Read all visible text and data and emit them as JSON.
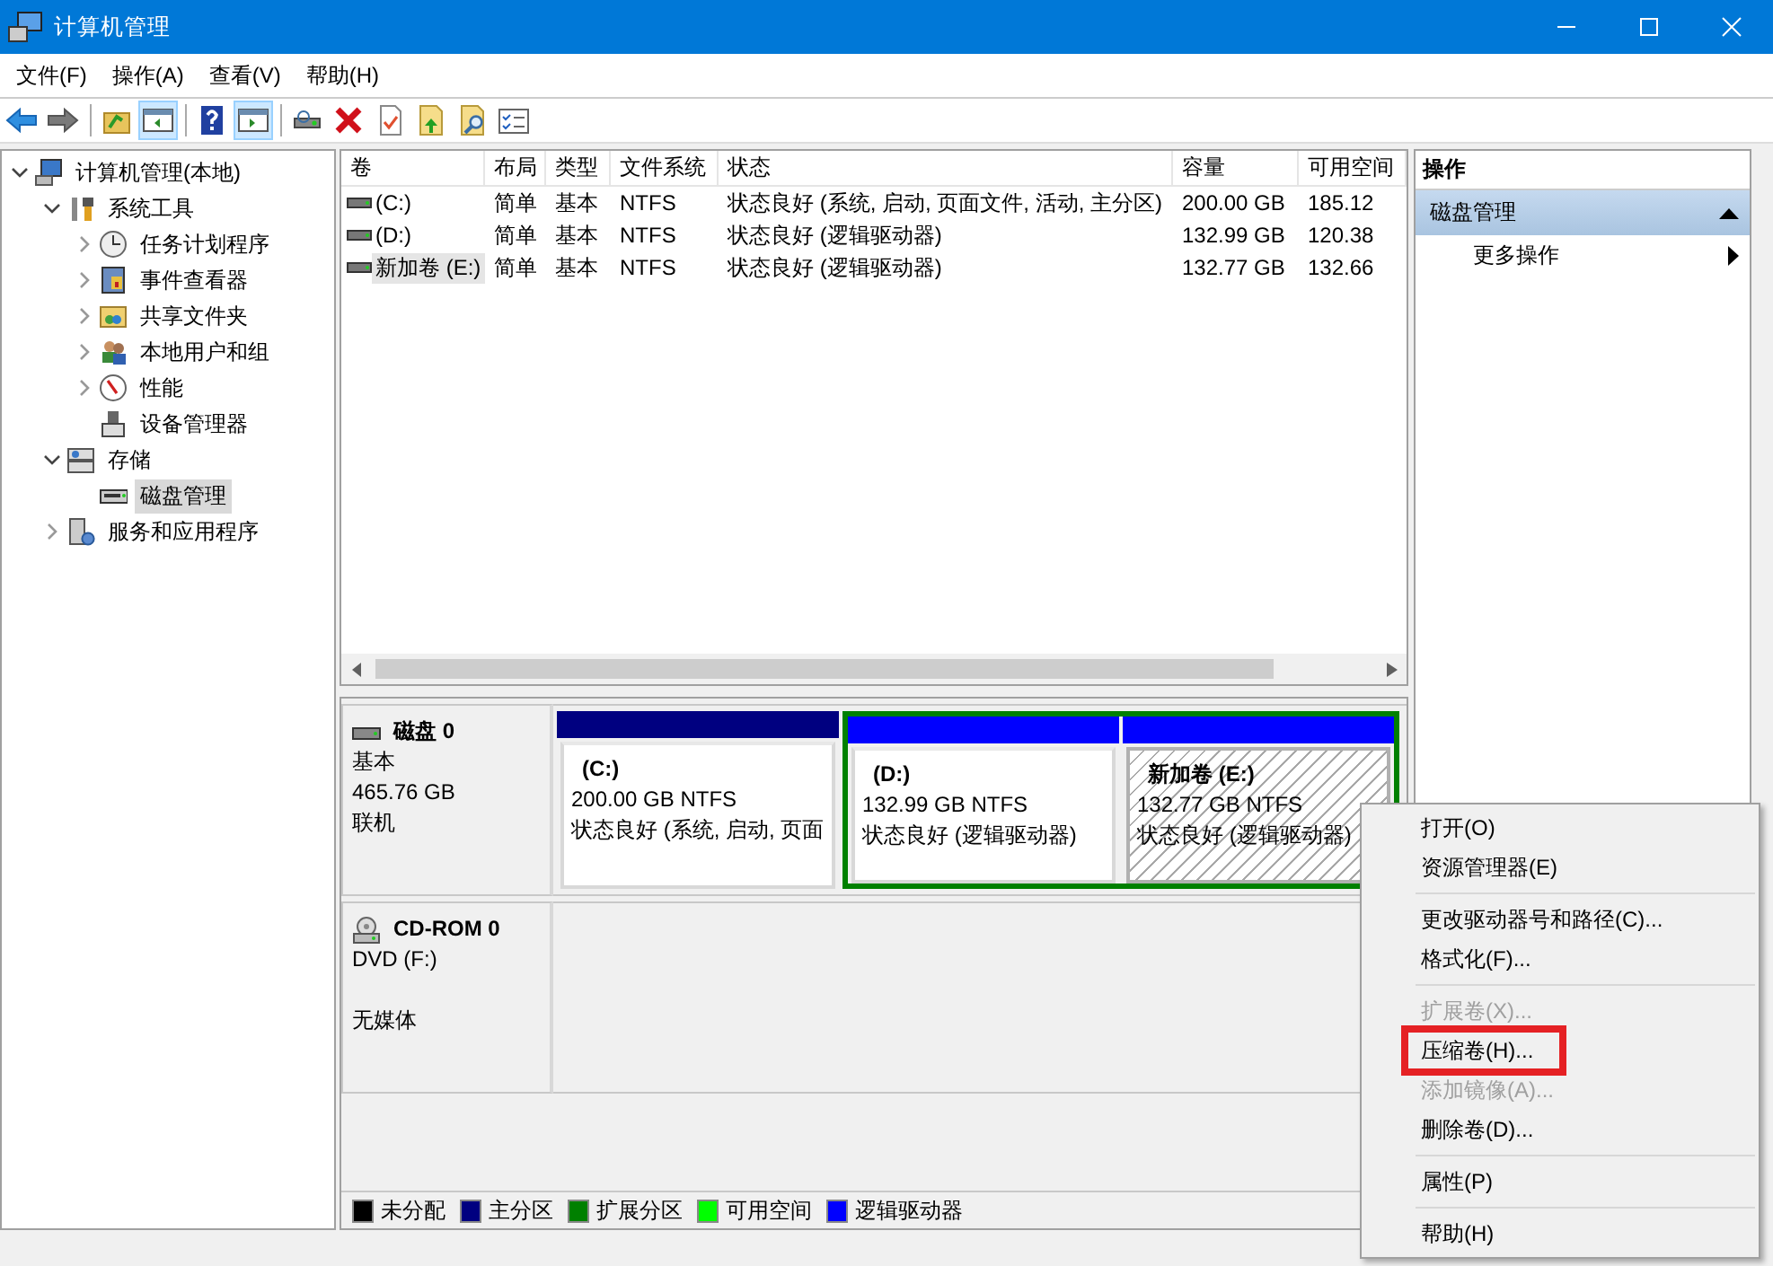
{
  "window": {
    "title": "计算机管理"
  },
  "menu_bar": [
    {
      "label": "文件(F)"
    },
    {
      "label": "操作(A)"
    },
    {
      "label": "查看(V)"
    },
    {
      "label": "帮助(H)"
    }
  ],
  "toolbar": [
    [
      {
        "kind": "back",
        "pressed": false
      },
      {
        "kind": "forward",
        "pressed": false
      }
    ],
    [
      {
        "kind": "up",
        "pressed": false
      },
      {
        "kind": "tree-pane",
        "pressed": true
      }
    ],
    [
      {
        "kind": "help",
        "pressed": false
      },
      {
        "kind": "action-pane",
        "pressed": true
      }
    ],
    [
      {
        "kind": "connect",
        "pressed": false
      },
      {
        "kind": "delete",
        "pressed": false
      },
      {
        "kind": "check",
        "pressed": false
      },
      {
        "kind": "folder-up",
        "pressed": false
      },
      {
        "kind": "folder-search",
        "pressed": false
      },
      {
        "kind": "checklist",
        "pressed": false
      }
    ]
  ],
  "tree": [
    {
      "label": "计算机管理(本地)",
      "kind": "computer",
      "selected": false,
      "expanded": true,
      "children": [
        {
          "label": "系统工具",
          "kind": "tools",
          "selected": false,
          "expanded": true,
          "children": [
            {
              "label": "任务计划程序",
              "kind": "clock",
              "selected": false,
              "expanded": false
            },
            {
              "label": "事件查看器",
              "kind": "event",
              "selected": false,
              "expanded": false
            },
            {
              "label": "共享文件夹",
              "kind": "share",
              "selected": false,
              "expanded": false
            },
            {
              "label": "本地用户和组",
              "kind": "users",
              "selected": false,
              "expanded": false
            },
            {
              "label": "性能",
              "kind": "perf",
              "selected": false,
              "expanded": false
            },
            {
              "label": "设备管理器",
              "kind": "device",
              "selected": false
            }
          ]
        },
        {
          "label": "存储",
          "kind": "storage",
          "selected": false,
          "expanded": true,
          "children": [
            {
              "label": "磁盘管理",
              "kind": "disk",
              "selected": true
            }
          ]
        },
        {
          "label": "服务和应用程序",
          "kind": "services",
          "selected": false,
          "expanded": false
        }
      ]
    }
  ],
  "volumes": {
    "columns": [
      "卷",
      "布局",
      "类型",
      "文件系统",
      "状态",
      "容量",
      "可用空间"
    ],
    "rows": [
      {
        "selected": false,
        "cells": [
          "(C:)",
          "简单",
          "基本",
          "NTFS",
          "状态良好 (系统, 启动, 页面文件, 活动, 主分区)",
          "200.00 GB",
          "185.12"
        ]
      },
      {
        "selected": false,
        "cells": [
          "(D:)",
          "简单",
          "基本",
          "NTFS",
          "状态良好 (逻辑驱动器)",
          "132.99 GB",
          "120.38"
        ]
      },
      {
        "selected": true,
        "cells": [
          "新加卷 (E:)",
          "简单",
          "基本",
          "NTFS",
          "状态良好 (逻辑驱动器)",
          "132.77 GB",
          "132.66"
        ]
      }
    ]
  },
  "disks": [
    {
      "kind": "disk",
      "name": "磁盘 0",
      "type": "基本",
      "size": "465.76 GB",
      "status": "联机",
      "partitions": [
        {
          "kind": "primary",
          "label": "(C:)",
          "size": "200.00 GB NTFS",
          "status": "状态良好 (系统, 启动, 页面",
          "color": "#000080",
          "selected": false
        },
        {
          "kind": "extended",
          "color": "#008000",
          "children": [
            {
              "label": "(D:)",
              "size": "132.99 GB NTFS",
              "status": "状态良好 (逻辑驱动器)",
              "color": "#0000ff",
              "selected": false
            },
            {
              "label": "新加卷  (E:)",
              "size": "132.77 GB NTFS",
              "status": "状态良好 (逻辑驱动器)",
              "color": "#0000ff",
              "selected": true
            }
          ]
        }
      ]
    },
    {
      "kind": "cdrom",
      "name": "CD-ROM 0",
      "type": "DVD (F:)",
      "status": "无媒体"
    }
  ],
  "legend": [
    {
      "label": "未分配",
      "color": "#000000"
    },
    {
      "label": "主分区",
      "color": "#000080"
    },
    {
      "label": "扩展分区",
      "color": "#008000"
    },
    {
      "label": "可用空间",
      "color": "#00ff00"
    },
    {
      "label": "逻辑驱动器",
      "color": "#0000ff"
    }
  ],
  "actions": {
    "title": "操作",
    "sections": [
      {
        "label": "磁盘管理",
        "expanded": true,
        "items": [
          {
            "label": "更多操作",
            "submenu": true
          }
        ]
      }
    ]
  },
  "context_menu": {
    "groups": [
      [
        {
          "label": "打开(O)",
          "disabled": false,
          "highlighted": false
        },
        {
          "label": "资源管理器(E)",
          "disabled": false,
          "highlighted": false
        }
      ],
      [
        {
          "label": "更改驱动器号和路径(C)...",
          "disabled": false,
          "highlighted": false
        },
        {
          "label": "格式化(F)...",
          "disabled": false,
          "highlighted": false
        }
      ],
      [
        {
          "label": "扩展卷(X)...",
          "disabled": true,
          "highlighted": false
        },
        {
          "label": "压缩卷(H)...",
          "disabled": false,
          "highlighted": true
        },
        {
          "label": "添加镜像(A)...",
          "disabled": true,
          "highlighted": false
        },
        {
          "label": "删除卷(D)...",
          "disabled": false,
          "highlighted": false
        }
      ],
      [
        {
          "label": "属性(P)",
          "disabled": false,
          "highlighted": false
        }
      ],
      [
        {
          "label": "帮助(H)",
          "disabled": false,
          "highlighted": false
        }
      ]
    ]
  }
}
